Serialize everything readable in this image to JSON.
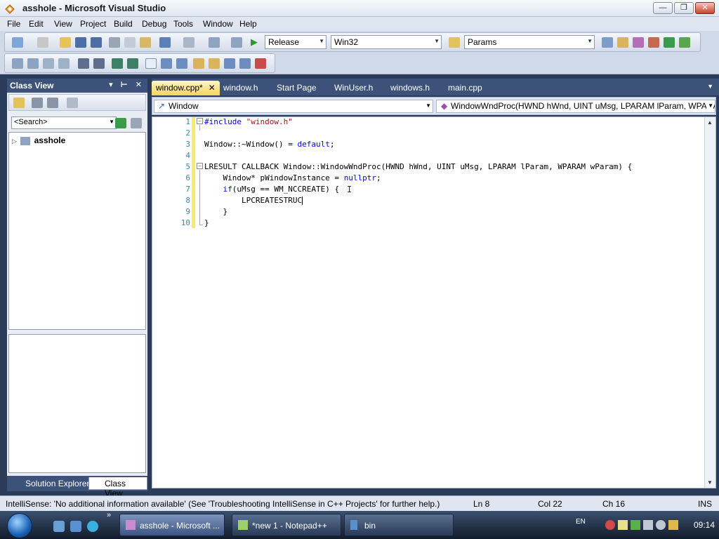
{
  "window": {
    "title": "asshole - Microsoft Visual Studio",
    "min": "0",
    "max": "1",
    "close": "r"
  },
  "menu": [
    "File",
    "Edit",
    "View",
    "Project",
    "Build",
    "Debug",
    "Tools",
    "Window",
    "Help"
  ],
  "toolbar": {
    "config": "Release",
    "platform": "Win32",
    "find": "Params"
  },
  "class_view": {
    "title": "Class View",
    "header_controls": "▾ ⊢ ✕",
    "search_placeholder": "<Search>",
    "tree_root": "asshole",
    "tabs": [
      "Solution Explorer",
      "Class View"
    ]
  },
  "doc_tabs": [
    {
      "label": "window.cpp*",
      "active": true
    },
    {
      "label": "window.h"
    },
    {
      "label": "Start Page"
    },
    {
      "label": "WinUser.h"
    },
    {
      "label": "windows.h"
    },
    {
      "label": "main.cpp"
    }
  ],
  "nav": {
    "scope": "Window",
    "member": "WindowWndProc(HWND hWnd, UINT uMsg, LPARAM lParam, WPARAM wP"
  },
  "code": {
    "line_numbers": [
      "1",
      "2",
      "3",
      "4",
      "5",
      "6",
      "7",
      "8",
      "9",
      "10"
    ],
    "l1_pre": "#include ",
    "l1_str": "\"window.h\"",
    "l3_pre": "Window::~Window() = ",
    "l3_kw": "default",
    "l3_post": ";",
    "l5": "LRESULT CALLBACK Window::WindowWndProc(HWND hWnd, UINT uMsg, LPARAM lParam, WPARAM wParam) {",
    "l6_pre": "    Window* pWindowInstance = ",
    "l6_kw": "nullptr",
    "l6_post": ";",
    "l7_kw": "if",
    "l7_post": "(uMsg == WM_NCCREATE) {",
    "l8": "        LPCREATESTRUC",
    "l9": "    }",
    "l10": "}"
  },
  "status": {
    "message": "IntelliSense: 'No additional information available' (See 'Troubleshooting IntelliSense in C++ Projects' for further help.)",
    "line": "Ln 8",
    "col": "Col 22",
    "ch": "Ch 16",
    "mode": "INS"
  },
  "taskbar": {
    "tasks": [
      "asshole - Microsoft ...",
      "*new 1 - Notepad++",
      "bin"
    ],
    "lang": "EN",
    "clock": "09:14"
  }
}
